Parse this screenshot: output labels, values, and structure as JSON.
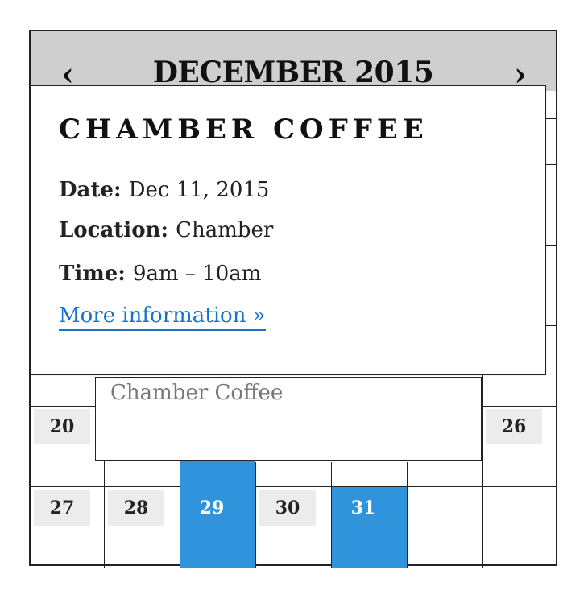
{
  "calendar": {
    "month_title": "DECEMBER 2015",
    "prev_label": "‹",
    "next_label": "›",
    "visible_days": {
      "d20": "20",
      "d26": "26",
      "d27": "27",
      "d28": "28",
      "d29": "29",
      "d30": "30",
      "d31": "31"
    },
    "event_day_color": "#2f94dc",
    "event_box_label": "Chamber Coffee"
  },
  "popup": {
    "title": "CHAMBER COFFEE",
    "date_label": "Date:",
    "date_value": "Dec 11, 2015",
    "location_label": "Location:",
    "location_value": "Chamber",
    "time_label": "Time:",
    "time_value": "9am – 10am",
    "more_link": "More information »",
    "link_color": "#1a73c8"
  }
}
